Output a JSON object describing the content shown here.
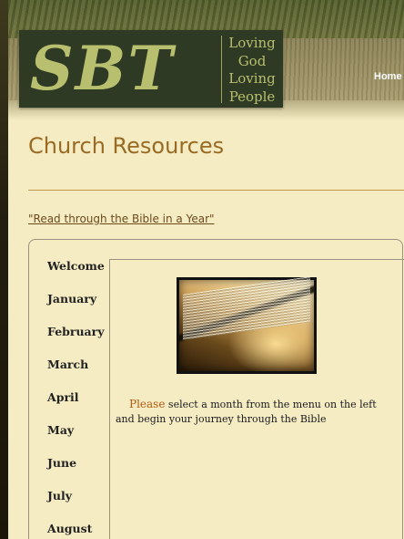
{
  "header": {
    "logo_text": "SBT",
    "motto": [
      "Loving",
      "God",
      "Loving",
      "People"
    ],
    "nav": {
      "home_label": "Home"
    }
  },
  "main": {
    "title": "Church Resources",
    "bible_link": "\"Read through the Bible in a Year\"",
    "months": [
      "Welcome",
      "January",
      "February",
      "March",
      "April",
      "May",
      "June",
      "July",
      "August"
    ],
    "intro_highlight": "Please",
    "intro_rest": " select a month from the menu on the left and begin your journey through the Bible",
    "image_label": "open-bible-image"
  },
  "colors": {
    "page_background": "#f6ecc4",
    "title": "#996a22",
    "logo_green": "#b8bf6e",
    "highlight": "#b55a10"
  }
}
